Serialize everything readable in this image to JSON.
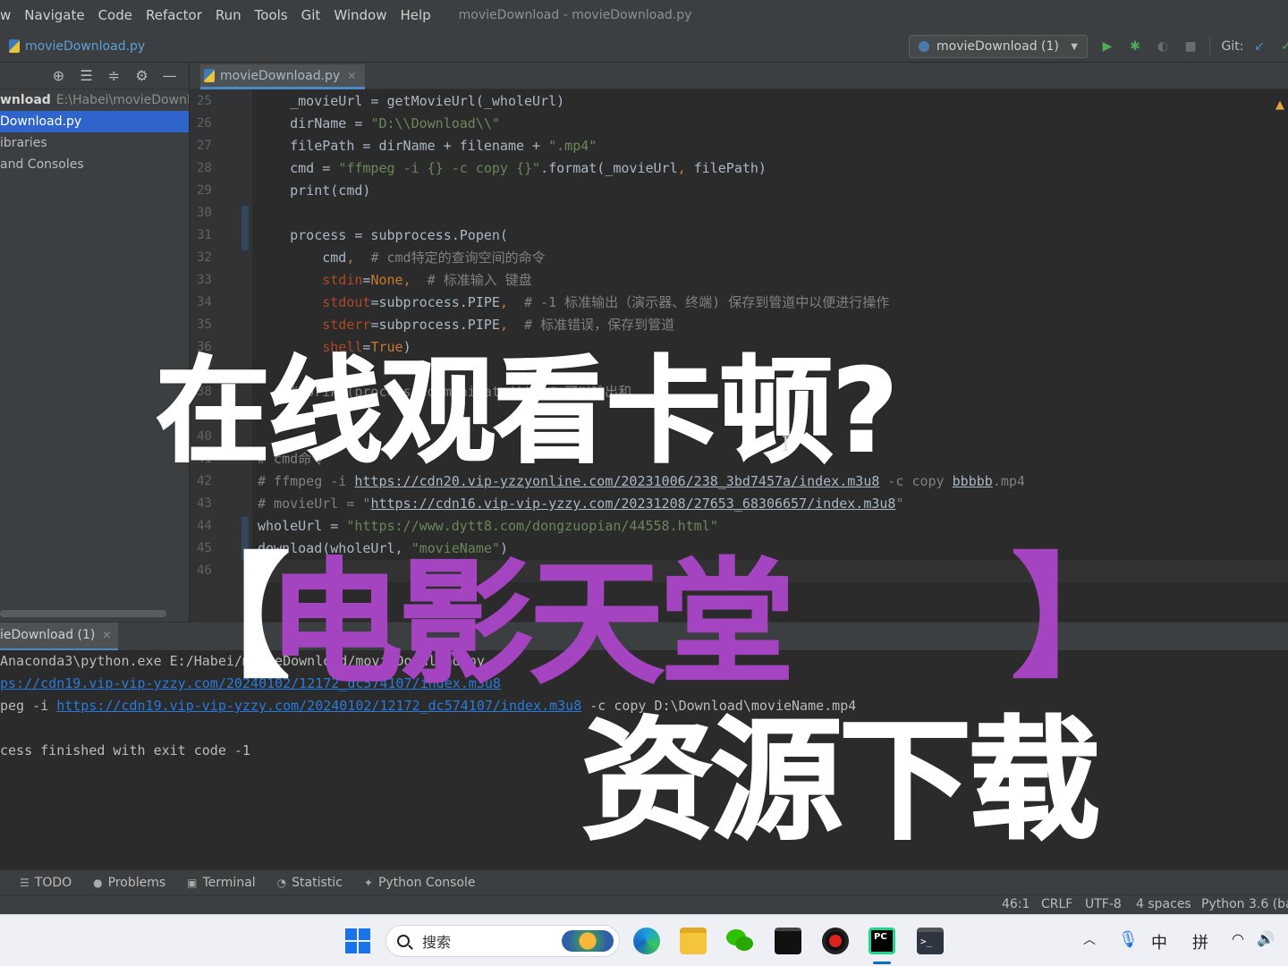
{
  "menu": {
    "items": [
      "w",
      "Navigate",
      "Code",
      "Refactor",
      "Run",
      "Tools",
      "Git",
      "Window",
      "Help"
    ],
    "window_title": "movieDownload - movieDownload.py"
  },
  "nav": {
    "breadcrumb": "movieDownload.py",
    "run_config": "movieDownload (1)",
    "git_label": "Git:"
  },
  "project": {
    "root_name": "wnload",
    "root_path": "E:\\Habei\\movieDownl",
    "rows": [
      "Download.py",
      "ibraries",
      "and Consoles"
    ]
  },
  "editor": {
    "tab_label": "movieDownload.py",
    "lines": [
      {
        "n": "25",
        "segments": [
          {
            "t": "    _movieUrl = getMovieUrl(_wholeUrl)",
            "c": ""
          }
        ]
      },
      {
        "n": "26",
        "segments": [
          {
            "t": "    dirName = ",
            "c": ""
          },
          {
            "t": "\"D:\\\\Download\\\\\"",
            "c": "str"
          }
        ]
      },
      {
        "n": "27",
        "segments": [
          {
            "t": "    filePath = dirName + filename + ",
            "c": ""
          },
          {
            "t": "\".mp4\"",
            "c": "str"
          }
        ]
      },
      {
        "n": "28",
        "segments": [
          {
            "t": "    cmd = ",
            "c": ""
          },
          {
            "t": "\"ffmpeg -i {} -c copy {}\"",
            "c": "str"
          },
          {
            "t": ".format(_movieUrl",
            "c": ""
          },
          {
            "t": ", ",
            "c": "kw"
          },
          {
            "t": "filePath)",
            "c": ""
          }
        ]
      },
      {
        "n": "29",
        "segments": [
          {
            "t": "    print(cmd)",
            "c": ""
          }
        ]
      },
      {
        "n": "30",
        "segments": [
          {
            "t": "",
            "c": ""
          }
        ]
      },
      {
        "n": "31",
        "segments": [
          {
            "t": "    process = subprocess.Popen(",
            "c": ""
          }
        ]
      },
      {
        "n": "32",
        "segments": [
          {
            "t": "        cmd",
            "c": ""
          },
          {
            "t": ",  ",
            "c": "kw"
          },
          {
            "t": "# cmd特定的查询空间的命令",
            "c": "cmt"
          }
        ]
      },
      {
        "n": "33",
        "segments": [
          {
            "t": "        ",
            "c": ""
          },
          {
            "t": "stdin",
            "c": "param"
          },
          {
            "t": "=",
            "c": ""
          },
          {
            "t": "None",
            "c": "kw"
          },
          {
            "t": ",  ",
            "c": "kw"
          },
          {
            "t": "# 标准输入 键盘",
            "c": "cmt"
          }
        ]
      },
      {
        "n": "34",
        "segments": [
          {
            "t": "        ",
            "c": ""
          },
          {
            "t": "stdout",
            "c": "param"
          },
          {
            "t": "=subprocess.PIPE",
            "c": ""
          },
          {
            "t": ",  ",
            "c": "kw"
          },
          {
            "t": "# -1 标准输出（演示器、终端) 保存到管道中以便进行操作",
            "c": "cmt"
          }
        ]
      },
      {
        "n": "35",
        "segments": [
          {
            "t": "        ",
            "c": ""
          },
          {
            "t": "stderr",
            "c": "param"
          },
          {
            "t": "=subprocess.PIPE",
            "c": ""
          },
          {
            "t": ",  ",
            "c": "kw"
          },
          {
            "t": "# 标准错误，保存到管道",
            "c": "cmt"
          }
        ]
      },
      {
        "n": "36",
        "segments": [
          {
            "t": "        ",
            "c": ""
          },
          {
            "t": "shell",
            "c": "param"
          },
          {
            "t": "=",
            "c": ""
          },
          {
            "t": "True",
            "c": "kw"
          },
          {
            "t": ")",
            "c": ""
          }
        ]
      },
      {
        "n": "37",
        "segments": [
          {
            "t": "",
            "c": ""
          }
        ]
      },
      {
        "n": "38",
        "segments": [
          {
            "t": "    ",
            "c": ""
          },
          {
            "t": "# print(process.communicate())  # 可以输出和",
            "c": "cmt"
          }
        ]
      },
      {
        "n": "39",
        "segments": [
          {
            "t": "",
            "c": ""
          }
        ]
      },
      {
        "n": "40",
        "segments": [
          {
            "t": "",
            "c": ""
          }
        ]
      },
      {
        "n": "41",
        "segments": [
          {
            "t": "# cmd命令",
            "c": "cmt"
          }
        ]
      },
      {
        "n": "42",
        "segments": [
          {
            "t": "# ffmpeg -i ",
            "c": "cmt"
          },
          {
            "t": "https://cdn20.vip-yzzyonline.com/20231006/238_3bd7457a/index.m3u8",
            "c": "cmt link"
          },
          {
            "t": " -c copy ",
            "c": "cmt"
          },
          {
            "t": "bbbbb",
            "c": "cmt link"
          },
          {
            "t": ".mp4",
            "c": "cmt"
          }
        ]
      },
      {
        "n": "43",
        "segments": [
          {
            "t": "# movieUrl = \"",
            "c": "cmt"
          },
          {
            "t": "https://cdn16.vip-vip-yzzy.com/20231208/27653_68306657/index.m3u8",
            "c": "cmt link"
          },
          {
            "t": "\"",
            "c": "cmt"
          }
        ]
      },
      {
        "n": "44",
        "segments": [
          {
            "t": "wholeUrl = ",
            "c": ""
          },
          {
            "t": "\"https://www.dytt8.com/dongzuopian/44558.html\"",
            "c": "str"
          }
        ]
      },
      {
        "n": "45",
        "segments": [
          {
            "t": "download(wholeUrl, ",
            "c": ""
          },
          {
            "t": "\"movieName\"",
            "c": "str"
          },
          {
            "t": ")",
            "c": ""
          }
        ]
      },
      {
        "n": "46",
        "segments": [
          {
            "t": "",
            "c": ""
          }
        ]
      }
    ]
  },
  "run": {
    "tab_label": "ieDownload (1)",
    "lines": [
      {
        "segments": [
          {
            "t": "Anaconda3\\python.exe E:/Habei/movieDownload/movieDownload.py",
            "c": ""
          }
        ]
      },
      {
        "segments": [
          {
            "t": "ps://cdn19.vip-vip-yzzy.com/20240102/12172_dc574107/index.m3u8",
            "c": "ul"
          }
        ]
      },
      {
        "segments": [
          {
            "t": "peg -i ",
            "c": ""
          },
          {
            "t": "https://cdn19.vip-vip-yzzy.com/20240102/12172_dc574107/index.m3u8",
            "c": "ul"
          },
          {
            "t": " -c copy D:\\Download\\movieName.mp4",
            "c": ""
          }
        ]
      },
      {
        "segments": [
          {
            "t": "",
            "c": ""
          }
        ]
      },
      {
        "segments": [
          {
            "t": "cess finished with exit code -1",
            "c": ""
          }
        ]
      }
    ]
  },
  "tool_windows": [
    {
      "icon": "list-icon",
      "label": "TODO"
    },
    {
      "icon": "problems-icon",
      "label": "Problems"
    },
    {
      "icon": "terminal-icon",
      "label": "Terminal"
    },
    {
      "icon": "statistic-icon",
      "label": "Statistic"
    },
    {
      "icon": "python-icon",
      "label": "Python Console"
    }
  ],
  "status": {
    "position": "46:1",
    "line_sep": "CRLF",
    "encoding": "UTF-8",
    "indent": "4 spaces",
    "interpreter": "Python 3.6 (ba"
  },
  "taskbar": {
    "search_placeholder": "搜索",
    "tray_lang1": "中",
    "tray_lang2": "拼"
  },
  "overlay": {
    "title": "在线观看卡顿?",
    "bracket_left": "【",
    "movie": "电影天堂",
    "bracket_right": "】",
    "subtitle": "资源下载"
  },
  "colors": {
    "accent_purple": "#a544c0",
    "ide_bg": "#2b2b2b",
    "selection_blue": "#2f65ca"
  }
}
